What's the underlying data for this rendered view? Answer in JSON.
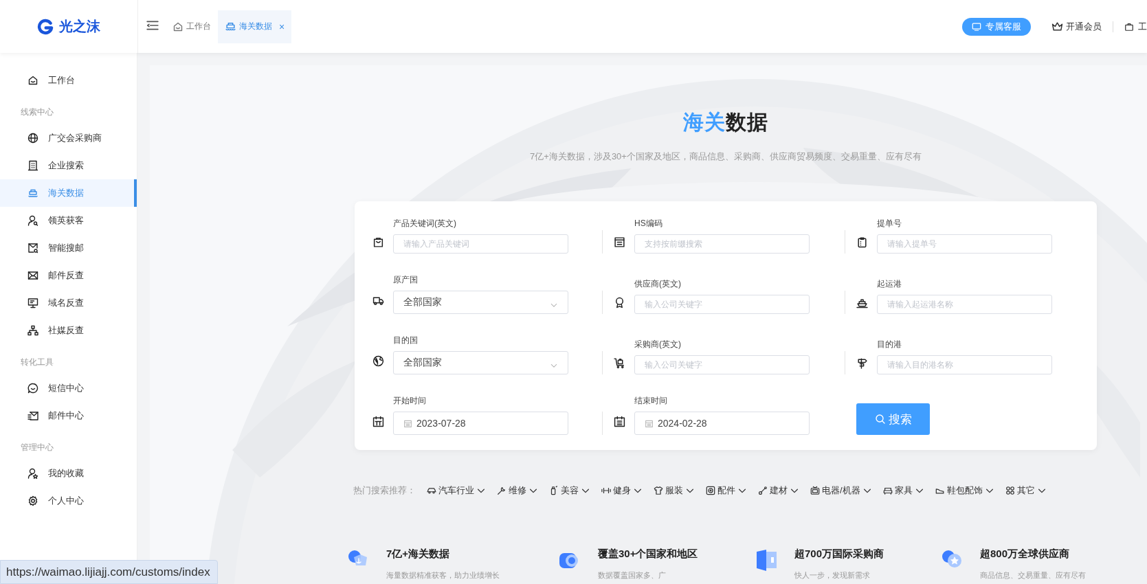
{
  "logo": {
    "text": "光之沫"
  },
  "tabs": [
    {
      "label": "工作台",
      "selected": false
    },
    {
      "label": "海关数据",
      "selected": true,
      "close": "×"
    }
  ],
  "header_actions": {
    "service_button": "专属客服",
    "membership": "开通会员",
    "cut_item": "工"
  },
  "sidebar": {
    "groups": [
      {
        "items": [
          {
            "label": "工作台",
            "selected": false
          }
        ]
      },
      {
        "heading": "线索中心",
        "items": [
          {
            "label": "广交会采购商",
            "selected": false
          },
          {
            "label": "企业搜索",
            "selected": false
          },
          {
            "label": "海关数据",
            "selected": true
          },
          {
            "label": "领英获客",
            "selected": false
          },
          {
            "label": "智能搜邮",
            "selected": false
          },
          {
            "label": "邮件反查",
            "selected": false
          },
          {
            "label": "域名反查",
            "selected": false
          },
          {
            "label": "社媒反查",
            "selected": false
          }
        ]
      },
      {
        "heading": "转化工具",
        "items": [
          {
            "label": "短信中心",
            "selected": false
          },
          {
            "label": "邮件中心",
            "selected": false
          }
        ]
      },
      {
        "heading": "管理中心",
        "items": [
          {
            "label": "我的收藏",
            "selected": false
          },
          {
            "label": "个人中心",
            "selected": false
          }
        ]
      }
    ]
  },
  "hero": {
    "title_highlight": "海关",
    "title_rest": "数据",
    "subtitle": "7亿+海关数据，涉及30+个国家及地区，商品信息、采购商、供应商贸易频度、交易重量、应有尽有"
  },
  "search_form": {
    "fields": [
      {
        "kind": "text",
        "label": "产品关键词(英文)",
        "placeholder": "请输入产品关键词"
      },
      {
        "kind": "text",
        "label": "HS编码",
        "placeholder": "支持按前缀搜索"
      },
      {
        "kind": "text",
        "label": "提单号",
        "placeholder": "请输入提单号"
      },
      {
        "kind": "select",
        "label": "原产国",
        "value": "全部国家"
      },
      {
        "kind": "text",
        "label": "供应商(英文)",
        "placeholder": "输入公司关键字"
      },
      {
        "kind": "text",
        "label": "起运港",
        "placeholder": "请输入起运港名称"
      },
      {
        "kind": "select",
        "label": "目的国",
        "value": "全部国家"
      },
      {
        "kind": "text",
        "label": "采购商(英文)",
        "placeholder": "输入公司关键字"
      },
      {
        "kind": "text",
        "label": "目的港",
        "placeholder": "请输入目的港名称"
      },
      {
        "kind": "date",
        "label": "开始时间",
        "value": "2023-07-28"
      },
      {
        "kind": "date",
        "label": "结束时间",
        "value": "2024-02-28"
      }
    ],
    "search_button": "搜索"
  },
  "hot_search": {
    "label": "热门搜索推荐：",
    "tags": [
      "汽车行业",
      "维修",
      "美容",
      "健身",
      "服装",
      "配件",
      "建材",
      "电器/机器",
      "家具",
      "鞋包配饰",
      "其它"
    ]
  },
  "features": [
    {
      "title": "7亿+海关数据",
      "description": "海量数据精准获客，助力业绩增长"
    },
    {
      "title": "覆盖30+个国家和地区",
      "description": "数据覆盖国家多、广"
    },
    {
      "title": "超700万国际采购商",
      "description": "快人一步，发现新需求"
    },
    {
      "title": "超800万全球供应商",
      "description": "商品信息、交易重量、应有尽有"
    }
  ],
  "status_url": "https://waimao.lijiajj.com/customs/index"
}
